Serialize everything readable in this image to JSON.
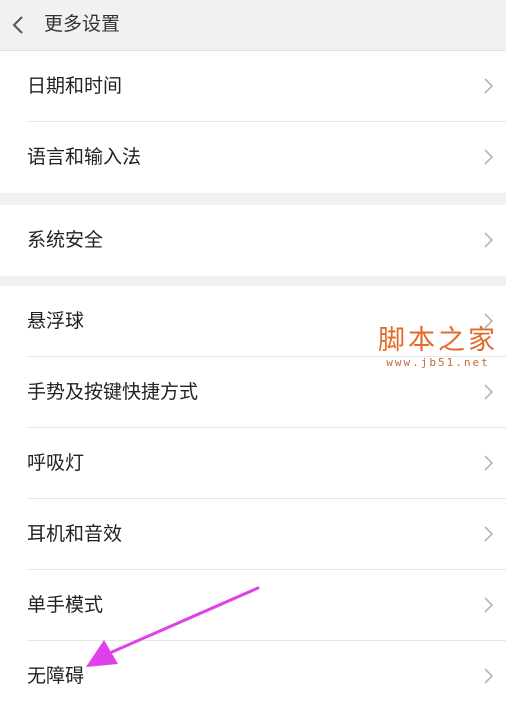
{
  "header": {
    "title": "更多设置",
    "back_icon": "chevron-left-icon"
  },
  "groups": [
    {
      "items": [
        {
          "label": "日期和时间"
        },
        {
          "label": "语言和输入法"
        }
      ]
    },
    {
      "items": [
        {
          "label": "系统安全"
        }
      ]
    },
    {
      "items": [
        {
          "label": "悬浮球"
        },
        {
          "label": "手势及按键快捷方式"
        },
        {
          "label": "呼吸灯"
        },
        {
          "label": "耳机和音效"
        },
        {
          "label": "单手模式"
        },
        {
          "label": "无障碍"
        }
      ]
    }
  ],
  "row_icon": "chevron-right-icon",
  "watermark": {
    "title": "脚本之家",
    "url": "www.jb51.net"
  },
  "annotation": {
    "color": "#e040e8",
    "target": "无障碍"
  }
}
